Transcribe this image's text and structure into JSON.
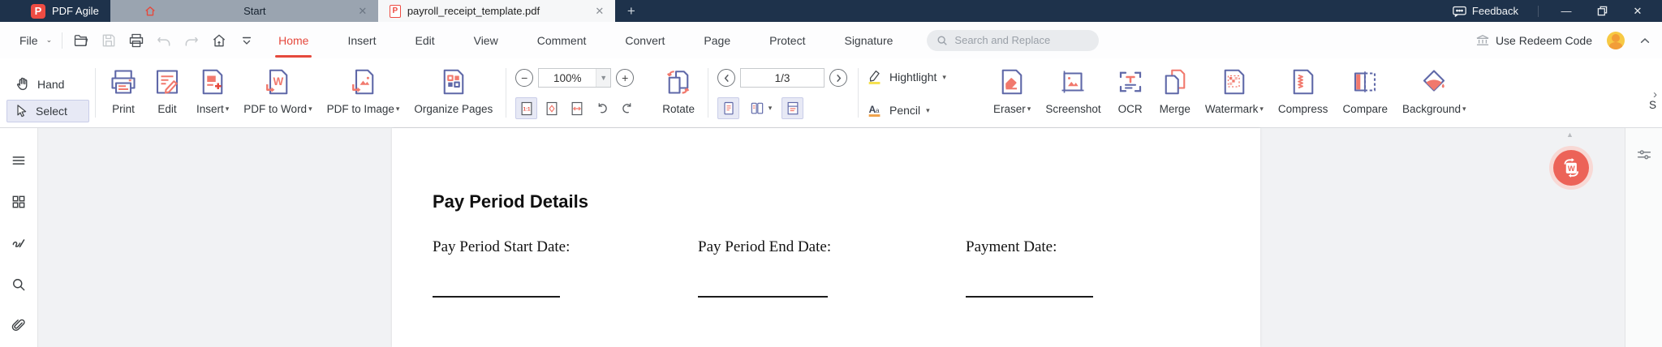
{
  "titlebar": {
    "app_name": "PDF Agile",
    "tab_start_label": "Start",
    "tab_document_label": "payroll_receipt_template.pdf",
    "close_glyph": "✕",
    "new_tab_glyph": "+",
    "feedback_label": "Feedback",
    "minimize_glyph": "—",
    "close_window_glyph": "✕"
  },
  "menubar": {
    "file_label": "File",
    "items": [
      {
        "label": "Home"
      },
      {
        "label": "Insert"
      },
      {
        "label": "Edit"
      },
      {
        "label": "View"
      },
      {
        "label": "Comment"
      },
      {
        "label": "Convert"
      },
      {
        "label": "Page"
      },
      {
        "label": "Protect"
      },
      {
        "label": "Signature"
      }
    ],
    "active_item": "Home",
    "search_placeholder": "Search and Replace",
    "redeem_label": "Use Redeem Code"
  },
  "toolbar": {
    "hand_label": "Hand",
    "select_label": "Select",
    "main_buttons": [
      {
        "label": "Print"
      },
      {
        "label": "Edit"
      },
      {
        "label": "Insert"
      },
      {
        "label": "PDF to Word"
      },
      {
        "label": "PDF to Image"
      },
      {
        "label": "Organize Pages"
      }
    ],
    "zoom_value": "100%",
    "rotate_label": "Rotate",
    "page_indicator": "1/3",
    "highlight_label": "Hightlight",
    "pencil_label": "Pencil",
    "right_buttons": [
      {
        "label": "Eraser"
      },
      {
        "label": "Screenshot"
      },
      {
        "label": "OCR"
      },
      {
        "label": "Merge"
      },
      {
        "label": "Watermark"
      },
      {
        "label": "Compress"
      },
      {
        "label": "Compare"
      },
      {
        "label": "Background"
      }
    ],
    "overflow_partial_label": "S"
  },
  "document": {
    "heading": "Pay Period Details",
    "fields": [
      {
        "label": "Pay Period Start Date:"
      },
      {
        "label": "Pay Period End Date:"
      },
      {
        "label": "Payment Date:"
      }
    ]
  },
  "colors": {
    "titlebar_navy": "#1e324b",
    "inactive_tab_gray": "#9aa4b0",
    "accent_red": "#e5493d",
    "logo_red": "#ee4c43",
    "icon_navy": "#5f68a8",
    "icon_salmon": "#f1796d",
    "selected_lavender": "#e7e9f5",
    "highlight_yellow": "#f5e04b",
    "pencil_underline_orange": "#f0a24b",
    "avatar_yellow": "#f7c944",
    "fab_red": "#ec6358"
  }
}
